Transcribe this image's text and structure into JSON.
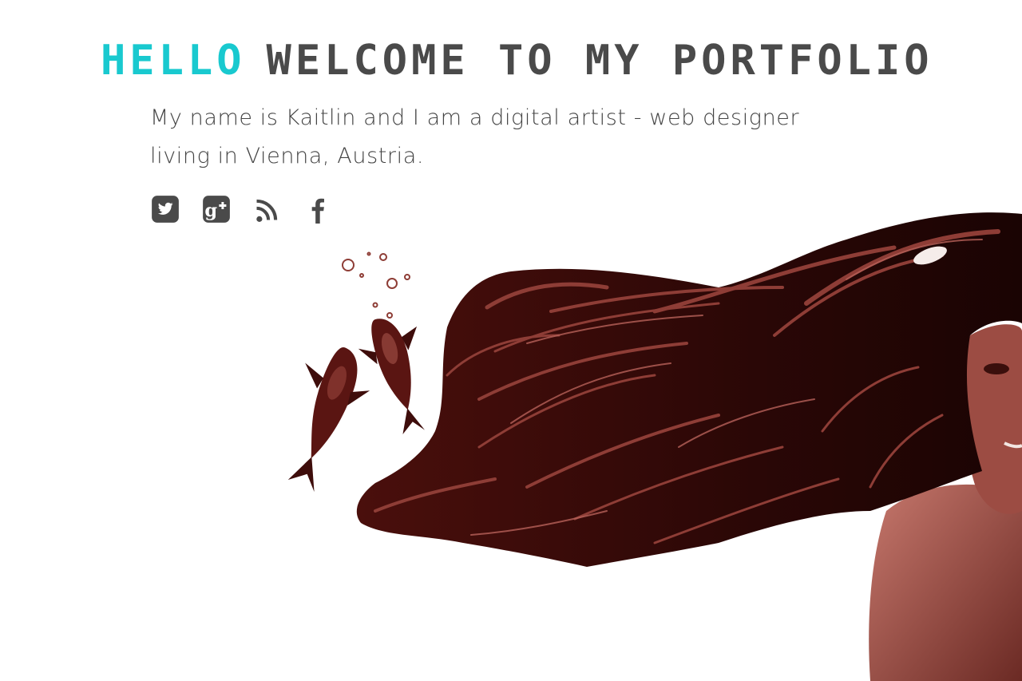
{
  "header": {
    "accent": "HELLO",
    "title": "WELCOME TO MY PORTFOLIO"
  },
  "intro": {
    "text": "My name is Kaitlin and I am a digital artist - web designer living in Vienna, Austria."
  },
  "social": {
    "links": [
      {
        "name": "twitter",
        "icon": "twitter-icon"
      },
      {
        "name": "google-plus",
        "icon": "google-plus-icon"
      },
      {
        "name": "rss",
        "icon": "rss-icon"
      },
      {
        "name": "facebook",
        "icon": "facebook-icon"
      }
    ]
  },
  "artwork": {
    "subject": "woman with flowing hair and koi fish"
  },
  "colors": {
    "accent": "#19c9cf",
    "title": "#4a4a4a",
    "text": "#444444",
    "hair": "#5a1512",
    "hair_light": "#8e3d36",
    "skin": "#a8584e",
    "background": "#ffffff"
  }
}
